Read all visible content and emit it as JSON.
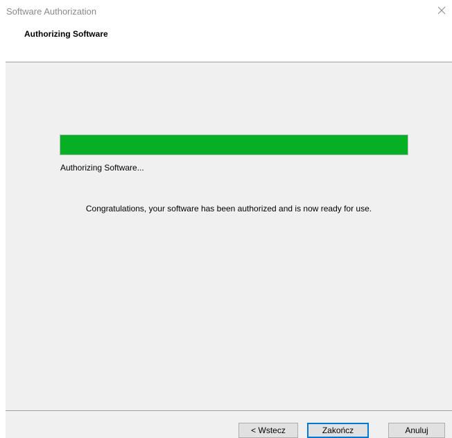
{
  "window": {
    "title": "Software Authorization",
    "close_icon": "close-icon"
  },
  "header": {
    "title": "Authorizing Software"
  },
  "main": {
    "progress": {
      "percent": 100,
      "color": "#06b025"
    },
    "status_text": "Authorizing Software...",
    "message": "Congratulations, your software has been authorized and is now ready for use."
  },
  "footer": {
    "back_label": "< Wstecz",
    "finish_label": "Zakończ",
    "cancel_label": "Anuluj"
  },
  "colors": {
    "accent": "#0078d7",
    "panel": "#f0f0f0"
  }
}
